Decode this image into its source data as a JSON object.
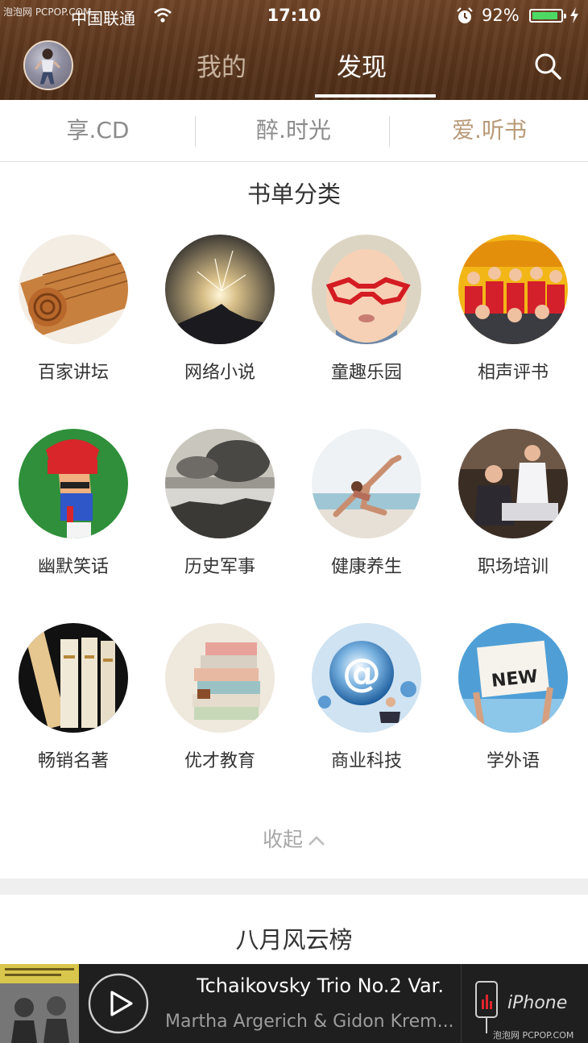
{
  "status_bar": {
    "watermark": "泡泡网 PCPOP.COM",
    "carrier": "中国联通",
    "time": "17:10",
    "battery": "92%",
    "battery_level": 0.92
  },
  "header": {
    "tabs": [
      {
        "label": "我的",
        "active": false
      },
      {
        "label": "发现",
        "active": true
      }
    ]
  },
  "subtabs": [
    "享.CD",
    "醉.时光",
    "爱.听书"
  ],
  "categories_title": "书单分类",
  "categories": [
    {
      "label": "百家讲坛"
    },
    {
      "label": "网络小说"
    },
    {
      "label": "童趣乐园"
    },
    {
      "label": "相声评书"
    },
    {
      "label": "幽默笑话"
    },
    {
      "label": "历史军事"
    },
    {
      "label": "健康养生"
    },
    {
      "label": "职场培训"
    },
    {
      "label": "畅销名著"
    },
    {
      "label": "优才教育"
    },
    {
      "label": "商业科技"
    },
    {
      "label": "学外语"
    }
  ],
  "collapse_label": "收起",
  "chart_title": "八月风云榜",
  "player": {
    "track": "Tchaikovsky Trio No.2 Var.",
    "artist": "Martha Argerich & Gidon Krem...",
    "device": "iPhone",
    "watermark": "泡泡网 PCPOP.COM"
  },
  "colors": {
    "header_brown": "#5a351c",
    "accent_tan": "#b89a78",
    "battery_green": "#4cd964",
    "player_bg": "#1f1f1f"
  }
}
